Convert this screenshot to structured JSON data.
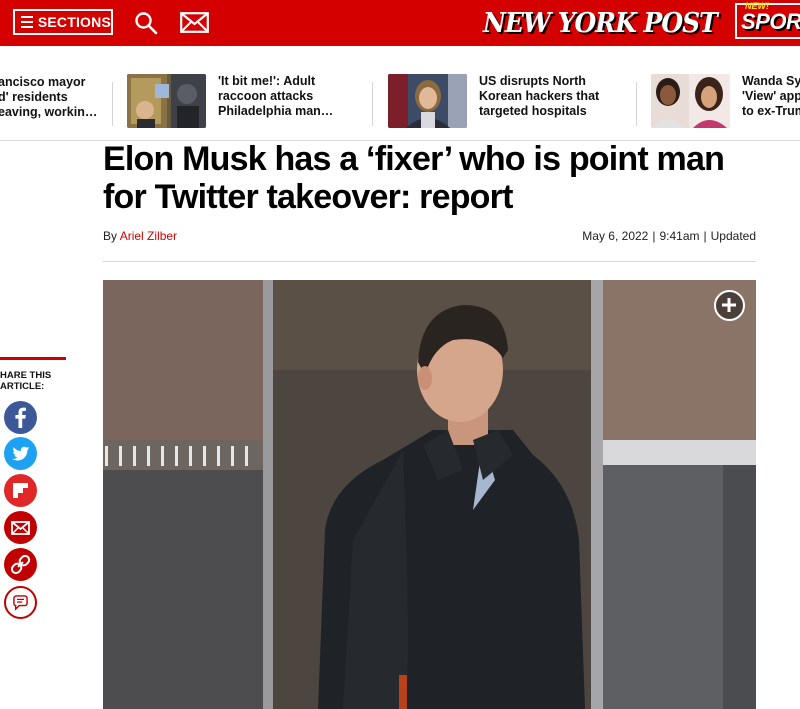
{
  "header": {
    "sections_label": "SECTIONS",
    "logo_text": "NEW YORK POST",
    "sports_badge": "NEW!",
    "sports_label": "SPORTS"
  },
  "strip": [
    {
      "lines": [
        "ancisco mayor",
        "d' residents",
        "eaving, workin…"
      ]
    },
    {
      "lines": [
        "'It bit me!': Adult",
        "raccoon attacks",
        "Philadelphia man…"
      ]
    },
    {
      "lines": [
        "US disrupts North",
        "Korean hackers that",
        "targeted hospitals"
      ]
    },
    {
      "lines": [
        "Wanda Sy",
        "'View' app",
        "to ex-Trum"
      ]
    }
  ],
  "article": {
    "headline": "Elon Musk has a ‘fixer’ who is point man for Twitter takeover: report",
    "by": "By",
    "author": "Ariel Zilber",
    "date": "May 6, 2022",
    "time": "9:41am",
    "updated": "Updated"
  },
  "share": {
    "label_line1": "HARE THIS",
    "label_line2": "ARTICLE:",
    "buttons": [
      "facebook-icon",
      "twitter-icon",
      "flipboard-icon",
      "email-icon",
      "link-icon",
      "comment-icon"
    ]
  },
  "colors": {
    "brand_red": "#d40000",
    "facebook": "#3b5998",
    "twitter": "#1da1f2",
    "flipboard": "#e12828",
    "email": "#c00000",
    "link": "#c00000"
  }
}
